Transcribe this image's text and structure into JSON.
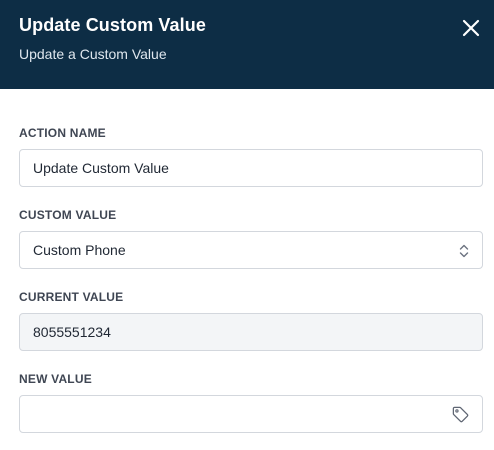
{
  "header": {
    "title": "Update Custom Value",
    "subtitle": "Update a Custom Value"
  },
  "fields": {
    "action_name": {
      "label": "ACTION NAME",
      "value": "Update Custom Value"
    },
    "custom_value": {
      "label": "CUSTOM VALUE",
      "value": "Custom Phone"
    },
    "current_value": {
      "label": "CURRENT VALUE",
      "value": "8055551234"
    },
    "new_value": {
      "label": "NEW VALUE",
      "value": ""
    }
  },
  "icons": {
    "close": "close-icon",
    "select": "chevron-up-down-icon",
    "tag": "tag-icon"
  },
  "colors": {
    "header_bg": "#0d2d45",
    "border": "#d3d7dd",
    "readonly_bg": "#f3f5f7",
    "label": "#3f4653"
  }
}
